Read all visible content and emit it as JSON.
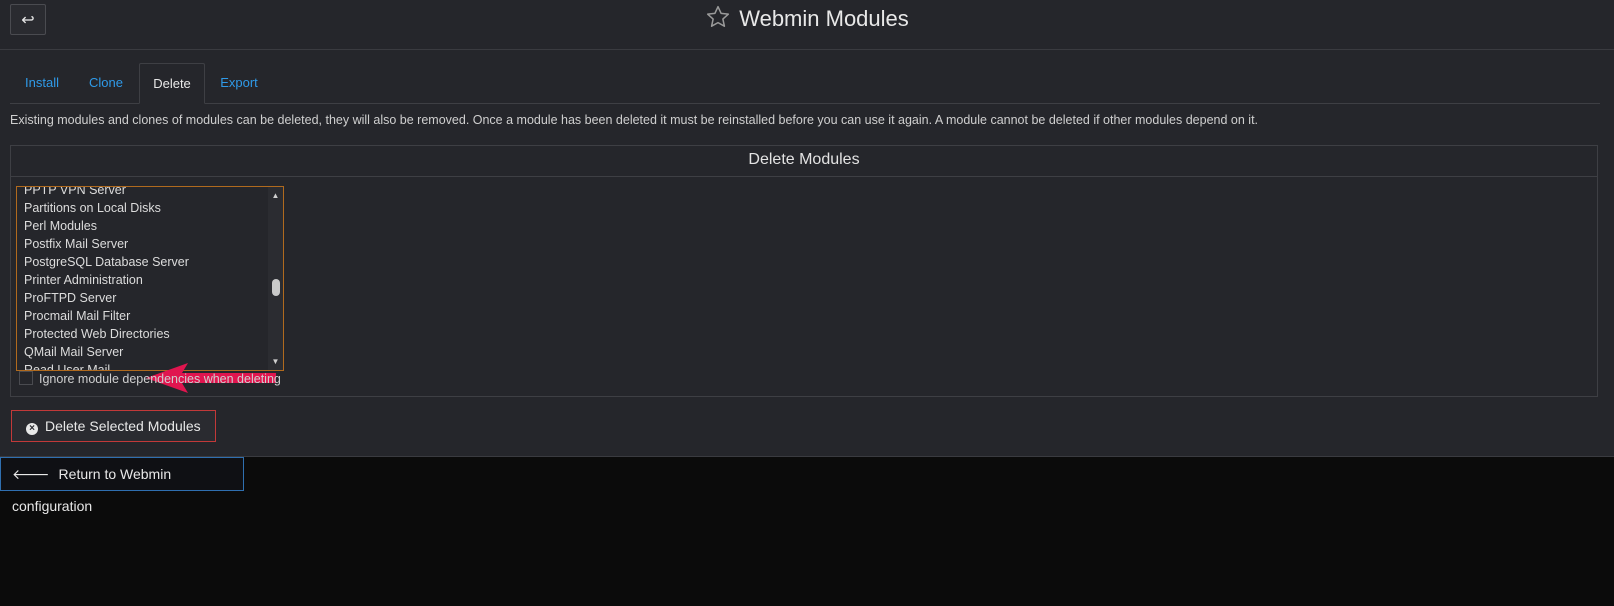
{
  "header": {
    "back_label": "↩",
    "title": "Webmin Modules"
  },
  "tabs": [
    {
      "label": "Install"
    },
    {
      "label": "Clone"
    },
    {
      "label": "Delete"
    },
    {
      "label": "Export"
    }
  ],
  "active_tab": "Delete",
  "description": "Existing modules and clones of modules can be deleted, they will also be removed. Once a module has been deleted it must be reinstalled before you can use it again. A module cannot be deleted if other modules depend on it.",
  "delete_box": {
    "heading": "Delete Modules",
    "modules": [
      "PPTP VPN Server",
      "Partitions on Local Disks",
      "Perl Modules",
      "Postfix Mail Server",
      "PostgreSQL Database Server",
      "Printer Administration",
      "ProFTPD Server",
      "Procmail Mail Filter",
      "Protected Web Directories",
      "QMail Mail Server",
      "Read User Mail"
    ],
    "ignore_deps_label": "Ignore module dependencies when deleting",
    "ignore_deps_checked": false
  },
  "delete_button_label": "Delete Selected Modules",
  "return_button_label": "Return to Webmin configuration",
  "colors": {
    "panel_bg": "#25262b",
    "page_bg": "#0b0b0b",
    "link_blue": "#2f9ae8",
    "danger_red": "#c23939",
    "arrow_red": "#e0154f"
  }
}
